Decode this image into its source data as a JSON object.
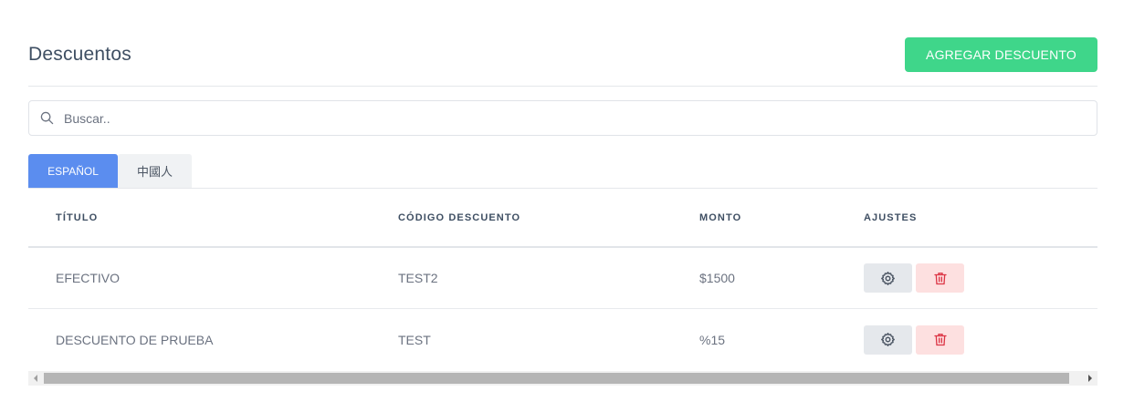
{
  "header": {
    "title": "Descuentos",
    "add_button_label": "AGREGAR DESCUENTO"
  },
  "search": {
    "placeholder": "Buscar..",
    "value": ""
  },
  "tabs": [
    {
      "label": "ESPAÑOL",
      "active": true
    },
    {
      "label": "中國人",
      "active": false
    }
  ],
  "table": {
    "columns": [
      "TÍTULO",
      "CÓDIGO DESCUENTO",
      "MONTO",
      "AJUSTES"
    ],
    "rows": [
      {
        "title": "EFECTIVO",
        "code": "TEST2",
        "amount": "$1500"
      },
      {
        "title": "DESCUENTO DE PRUEBA",
        "code": "TEST",
        "amount": "%15"
      }
    ]
  },
  "icons": {
    "search": "search-icon",
    "settings": "gear-icon",
    "delete": "trash-icon"
  },
  "colors": {
    "primary_green": "#3fd68a",
    "tab_active": "#5b8def",
    "delete_bg": "#fde0e0",
    "delete_icon": "#dc3545"
  }
}
